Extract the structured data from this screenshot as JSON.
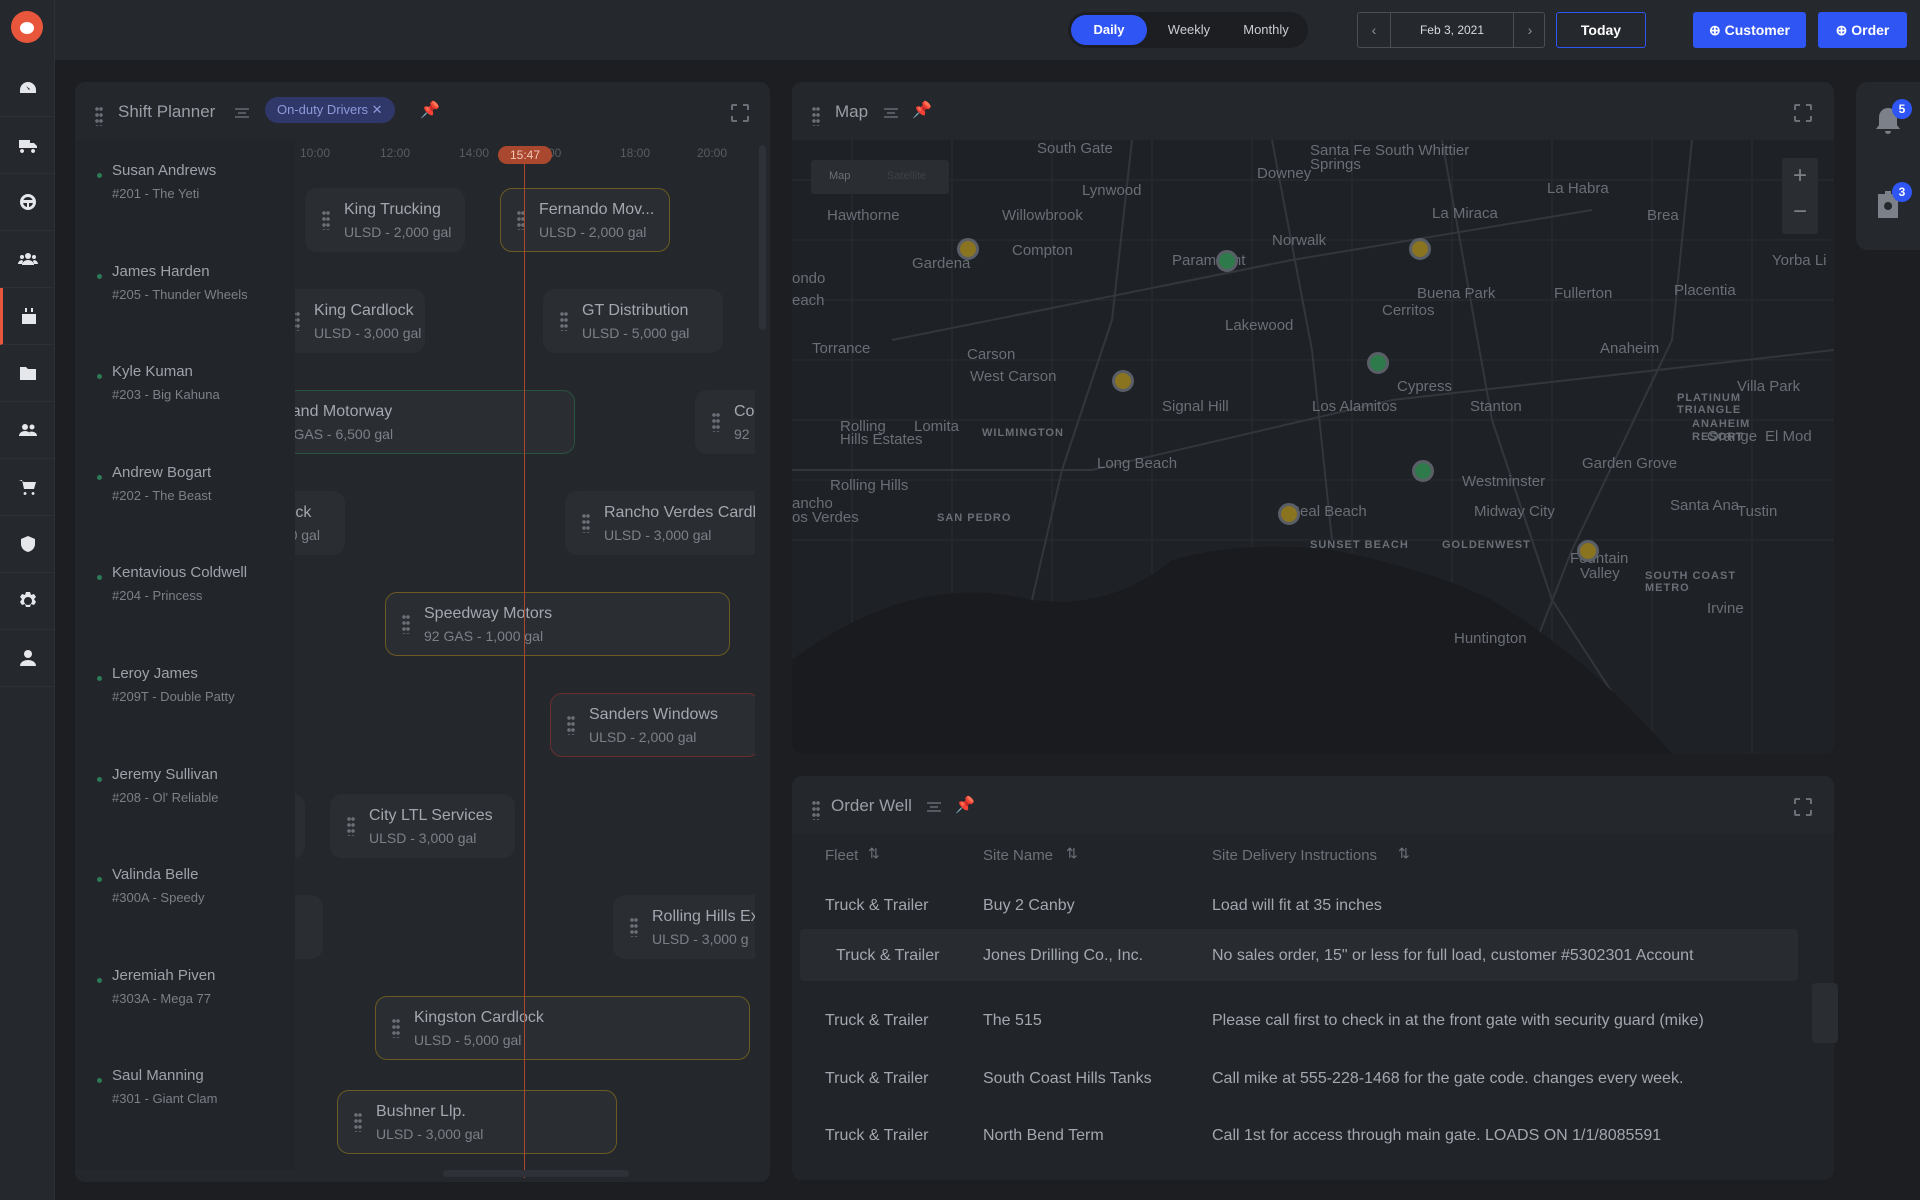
{
  "topbar": {
    "views": [
      "Daily",
      "Weekly",
      "Monthly"
    ],
    "active_view": "Daily",
    "date": "Feb 3, 2021",
    "prev_icon": "chevron-left-icon",
    "next_icon": "chevron-right-icon",
    "today_label": "Today",
    "customer_label": "⊕ Customer",
    "order_label": "⊕ Order"
  },
  "sidebar": {
    "items": [
      "dashboard",
      "trucks",
      "drivers",
      "groups",
      "schedule",
      "files",
      "contacts",
      "orders",
      "security",
      "settings",
      "account"
    ],
    "active": "schedule"
  },
  "shift_planner": {
    "title": "Shift Planner",
    "chip": "On-duty Drivers ✕",
    "ticks": [
      "10:00",
      "12:00",
      "14:00",
      "00",
      "18:00",
      "20:00"
    ],
    "now": "15:47",
    "drivers": [
      {
        "name": "Susan Andrews",
        "sub": "#201 - The Yeti"
      },
      {
        "name": "James Harden",
        "sub": "#205 - Thunder Wheels"
      },
      {
        "name": "Kyle Kuman",
        "sub": "#203 - Big Kahuna"
      },
      {
        "name": "Andrew Bogart",
        "sub": "#202 - The Beast"
      },
      {
        "name": "Kentavious Coldwell",
        "sub": "#204 - Princess"
      },
      {
        "name": "Leroy James",
        "sub": "#209T - Double Patty"
      },
      {
        "name": "Jeremy Sullivan",
        "sub": "#208 - Ol' Reliable"
      },
      {
        "name": "Valinda Belle",
        "sub": "#300A - Speedy"
      },
      {
        "name": "Jeremiah Piven",
        "sub": "#303A - Mega 77"
      },
      {
        "name": "Saul Manning",
        "sub": "#301 - Giant Clam"
      }
    ],
    "jobs": [
      {
        "name": "King Trucking",
        "sub": "ULSD - 2,000 gal"
      },
      {
        "name": "Fernando Mov...",
        "sub": "ULSD - 2,000 gal"
      },
      {
        "name": "King Cardlock",
        "sub": "ULSD - 3,000 gal"
      },
      {
        "name": "GT Distribution",
        "sub": "ULSD - 5,000 gal"
      },
      {
        "name": "Grand Motorway",
        "sub": "92 GAS - 6,500 gal"
      },
      {
        "name": "Co",
        "sub": "92"
      },
      {
        "name": "dlock",
        "sub": "000 gal"
      },
      {
        "name": "Rancho Verdes Cardl",
        "sub": "ULSD - 3,000 gal"
      },
      {
        "name": "Speedway Motors",
        "sub": "92 GAS - 1,000 gal"
      },
      {
        "name": "Sanders Windows",
        "sub": "ULSD - 2,000 gal"
      },
      {
        "name": "City LTL Services",
        "sub": "ULSD - 3,000 gal"
      },
      {
        "name": "al",
        "sub": ""
      },
      {
        "name": "k",
        "sub": "gal"
      },
      {
        "name": "Rolling Hills Ex",
        "sub": "ULSD - 3,000 g"
      },
      {
        "name": "Kingston Cardlock",
        "sub": "ULSD - 5,000 gal"
      },
      {
        "name": "Bushner Llp.",
        "sub": "ULSD - 3,000 gal"
      }
    ]
  },
  "map": {
    "title": "Map",
    "toggle": [
      "Map",
      "Satellite"
    ],
    "labels": [
      "South Gate",
      "Downey",
      "Santa Fe South Whittier",
      "Springs",
      "Lynwood",
      "La Habra",
      "Hawthorne",
      "Willowbrook",
      "La Miraca",
      "Brea",
      "Compton",
      "Paramount",
      "Norwalk",
      "Gardena",
      "Yorba Li",
      "ondo",
      "Buena Park",
      "Fullerton",
      "Placentia",
      "each",
      "Lakewood",
      "Cerritos",
      "Torrance",
      "Carson",
      "Anaheim",
      "West Carson",
      "Cypress",
      "Villa Park",
      "Signal Hill",
      "Los Alamitos",
      "Stanton",
      "PLATINUM",
      "TRIANGLE",
      "Rolling",
      "Lomita",
      "Hills Estates",
      "WILMINGTON",
      "ANAHEIM",
      "RESORT",
      "Orange",
      "El Mod",
      "Long Beach",
      "Garden Grove",
      "Westminster",
      "Rolling Hills",
      "ancho",
      "os Verdes",
      "Seal Beach",
      "Midway City",
      "Santa Ana",
      "Tustin",
      "SAN PEDRO",
      "SUNSET BEACH",
      "GOLDENWEST",
      "Fountain",
      "Valley",
      "SOUTH COAST",
      "METRO",
      "Irvine",
      "Huntington"
    ],
    "zoom_in": "+",
    "zoom_out": "−"
  },
  "order_well": {
    "title": "Order Well",
    "headers": [
      "Fleet",
      "Site Name",
      "Site Delivery Instructions"
    ],
    "rows": [
      {
        "fleet": "Truck & Trailer",
        "site": "Buy 2 Canby",
        "instr": "Load will fit at 35 inches"
      },
      {
        "fleet": "Truck & Trailer",
        "site": "Jones Drilling Co., Inc.",
        "instr": "No sales order, 15\" or less for full load, customer #5302301 Account"
      },
      {
        "fleet": "Truck & Trailer",
        "site": "The 515",
        "instr": "Please call first to check in at the front gate with security guard (mike)"
      },
      {
        "fleet": "Truck & Trailer",
        "site": "South Coast Hills Tanks",
        "instr": "Call mike at 555-228-1468 for the gate code. changes every week."
      },
      {
        "fleet": "Truck & Trailer",
        "site": "North Bend Term",
        "instr": "Call 1st for access through main gate. LOADS ON 1/1/8085591"
      }
    ]
  },
  "right": {
    "notifications": "5",
    "contacts": "3"
  },
  "colors": {
    "accent": "#2f55f5",
    "active_nav": "#e8573c",
    "now_line": "#a9472f"
  }
}
